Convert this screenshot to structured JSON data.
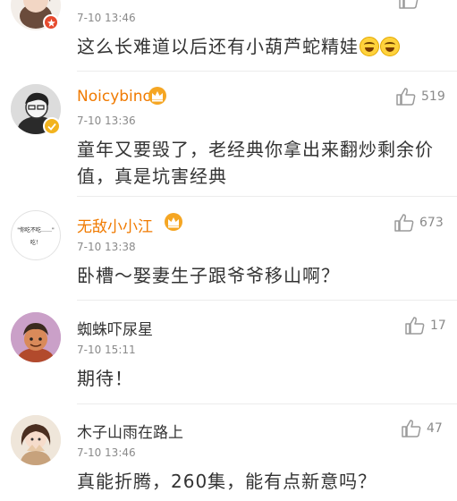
{
  "comments": [
    {
      "username": "",
      "time": "7-10 13:46",
      "text": "这么长难道以后还有小葫芦蛇精娃",
      "emoji_icons": [
        "laughing-tears-icon",
        "laughing-tears-icon"
      ],
      "likes": ""
    },
    {
      "username": "Noicybino",
      "time": "7-10 13:36",
      "text": "童年又要毁了，老经典你拿出来翻炒剩余价值，真是坑害经典",
      "likes": "519"
    },
    {
      "username": "无敌小小江",
      "time": "7-10 13:38",
      "avatar_text_line1": "\"你吃不吃……\"",
      "avatar_text_line2": "吃！",
      "text": "卧槽～娶妻生子跟爷爷移山啊？",
      "likes": "673"
    },
    {
      "username": "蜘蛛吓尿星",
      "time": "7-10 15:11",
      "text": "期待！",
      "likes": "17"
    },
    {
      "username": "木子山雨在路上",
      "time": "7-10 13:46",
      "text": "真能折腾，260集，能有点新意吗？",
      "likes": "47"
    }
  ],
  "colors": {
    "vip_name": "#f07a00",
    "normal_name": "#333333",
    "meta": "#8a8a8a",
    "divider": "#ececec",
    "crown": "#f5a623"
  }
}
